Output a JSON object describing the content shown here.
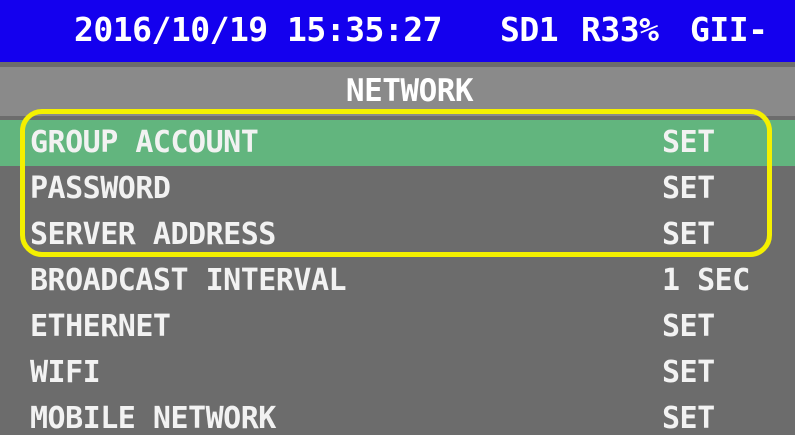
{
  "status_bar": {
    "datetime": "2016/10/19 15:35:27",
    "storage": "SD1",
    "record": "R33%",
    "model": "GII-",
    "background_color": "#1400ee"
  },
  "title": "NETWORK",
  "menu": {
    "items": [
      {
        "label": "GROUP ACCOUNT",
        "value": "SET",
        "selected": true
      },
      {
        "label": "PASSWORD",
        "value": "SET",
        "selected": false
      },
      {
        "label": "SERVER ADDRESS",
        "value": "SET",
        "selected": false
      },
      {
        "label": "BROADCAST INTERVAL",
        "value": "1 SEC",
        "selected": false
      },
      {
        "label": "ETHERNET",
        "value": "SET",
        "selected": false
      },
      {
        "label": "WIFI",
        "value": "SET",
        "selected": false
      },
      {
        "label": "MOBILE NETWORK",
        "value": "SET",
        "selected": false
      }
    ],
    "selected_color": "#62b57e",
    "background_color": "#6c6c6c"
  },
  "annotation": {
    "color": "#f4f000"
  }
}
